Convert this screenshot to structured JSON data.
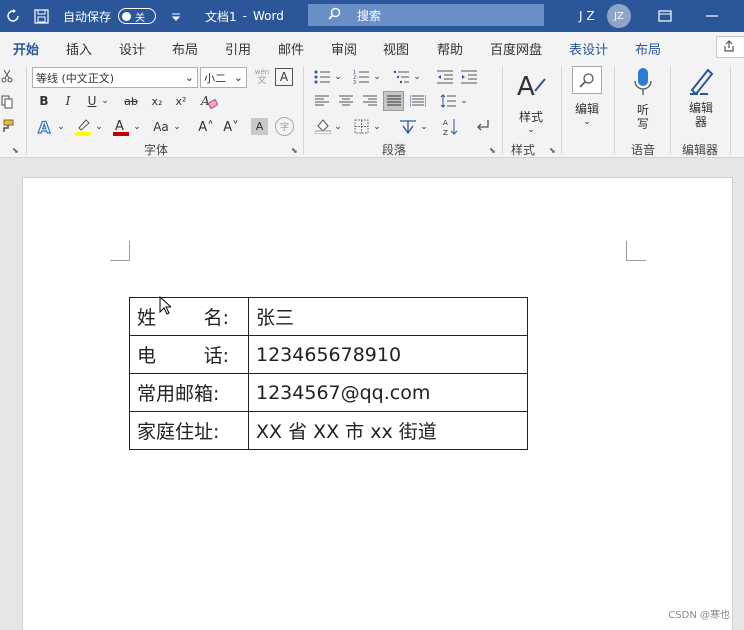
{
  "titlebar": {
    "autosave_label": "自动保存",
    "autosave_state": "关",
    "doc_title": "文档1",
    "title_sep": "-",
    "app_name": "Word",
    "search_placeholder": "搜索",
    "user_initials": "J Z",
    "avatar_initials": "JZ"
  },
  "tabs": [
    "开始",
    "插入",
    "设计",
    "布局",
    "引用",
    "邮件",
    "审阅",
    "视图",
    "帮助",
    "百度网盘",
    "表设计",
    "布局"
  ],
  "ribbon": {
    "font_name": "等线 (中文正文)",
    "font_size": "小二",
    "wen_top": "wén",
    "wen_bottom": "文",
    "big_a": "A",
    "bold": "B",
    "italic": "I",
    "underline": "U",
    "strike": "ab",
    "sub": "x₂",
    "sup": "x²",
    "change_case": "Aa",
    "grow": "A˄",
    "shrink": "A˅",
    "char_border": "A",
    "enclose": "字",
    "group_font": "字体",
    "group_paragraph": "段落",
    "styles_label": "样式",
    "group_styles": "样式",
    "editing_label": "编辑",
    "dictate_label": "听写",
    "group_voice": "语音",
    "editor_label": "编辑器",
    "group_editor": "编辑器"
  },
  "table": {
    "rows": [
      {
        "label_a": "姓",
        "label_b": "名:",
        "value": "张三"
      },
      {
        "label_a": "电",
        "label_b": "话:",
        "value": "123465678910"
      },
      {
        "label": "常用邮箱:",
        "value": "1234567@qq.com"
      },
      {
        "label": "家庭住址:",
        "value": "XX 省 XX 市 xx 街道"
      }
    ]
  },
  "watermark": "CSDN @寒也",
  "colors": {
    "brand": "#2b579a",
    "highlight": "#ffff00",
    "font_color": "#c00000",
    "text_effect": "#2b74c7"
  }
}
